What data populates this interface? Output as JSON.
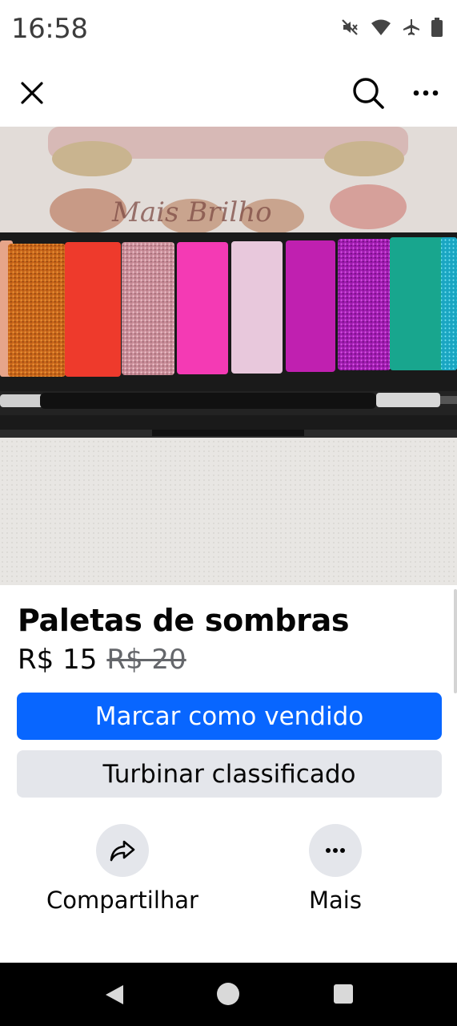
{
  "status_bar": {
    "time": "16:58",
    "icons": [
      "mute-icon",
      "wifi-icon",
      "airplane-icon",
      "battery-icon"
    ]
  },
  "top_nav": {
    "icons": [
      "close-icon",
      "search-icon",
      "more-icon"
    ]
  },
  "listing": {
    "photo_subject": "eyeshadow-palette-photo",
    "title": "Paletas de sombras",
    "price": "R$ 15",
    "original_price": "R$ 20"
  },
  "buttons": {
    "primary_label": "Marcar como vendido",
    "secondary_label": "Turbinar classificado"
  },
  "actions": {
    "share_label": "Compartilhar",
    "more_label": "Mais"
  },
  "colors": {
    "primary_button": "#0866ff",
    "secondary_button": "#e4e6eb",
    "text": "#050505",
    "muted_text": "#65676b"
  }
}
